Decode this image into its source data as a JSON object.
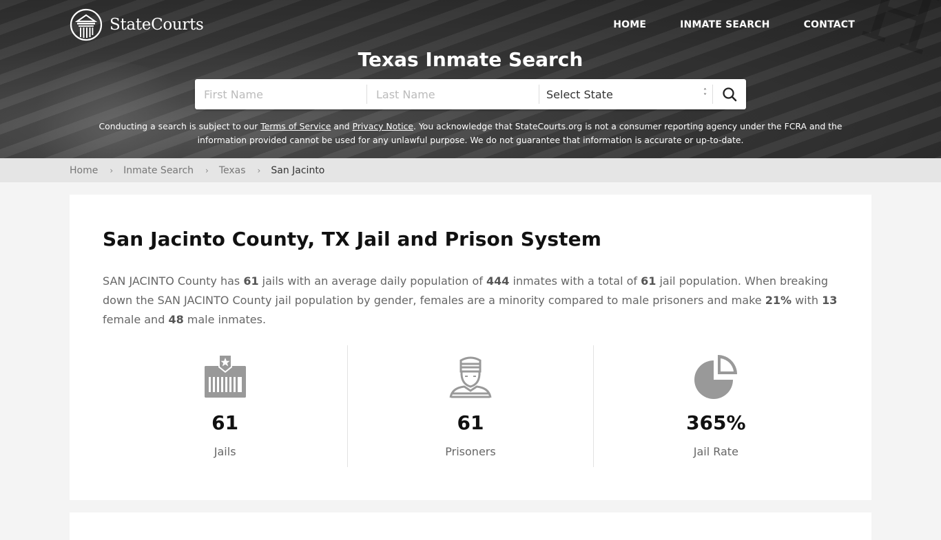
{
  "header": {
    "logo_text": "StateCourts",
    "nav": [
      {
        "label": "HOME"
      },
      {
        "label": "INMATE SEARCH"
      },
      {
        "label": "CONTACT"
      }
    ],
    "background_carving": "RT · HOUSE"
  },
  "hero": {
    "title": "Texas Inmate Search",
    "search": {
      "first_name_placeholder": "First Name",
      "first_name_value": "",
      "last_name_placeholder": "Last Name",
      "last_name_value": "",
      "state_selected": "Select State",
      "search_icon": "search-icon"
    },
    "disclaimer": {
      "part1": "Conducting a search is subject to our ",
      "terms_link": "Terms of Service",
      "part2": " and ",
      "privacy_link": "Privacy Notice",
      "part3": ". You acknowledge that StateCourts.org is not a consumer reporting agency under the FCRA and the information provided cannot be used for any unlawful purpose. We do not guarantee that information is accurate or up-to-date."
    }
  },
  "breadcrumb": {
    "items": [
      {
        "label": "Home"
      },
      {
        "label": "Inmate Search"
      },
      {
        "label": "Texas"
      }
    ],
    "current": "San Jacinto",
    "separator": "›"
  },
  "main": {
    "title": "San Jacinto County, TX Jail and Prison System",
    "intro": {
      "t1": "SAN JACINTO County has ",
      "jails": "61",
      "t2": " jails with an average daily population of ",
      "avg_pop": "444",
      "t3": " inmates with a total of ",
      "total": "61",
      "t4": " jail population. When breaking down the SAN JACINTO County jail population by gender, females are a minority compared to male prisoners and make ",
      "female_pct": "21%",
      "t5": " with ",
      "female_count": "13",
      "t6": " female and ",
      "male_count": "48",
      "t7": " male inmates."
    },
    "stats": [
      {
        "icon": "jail-icon",
        "value": "61",
        "label": "Jails"
      },
      {
        "icon": "prisoner-icon",
        "value": "61",
        "label": "Prisoners"
      },
      {
        "icon": "pie-chart-icon",
        "value": "365%",
        "label": "Jail Rate"
      }
    ]
  },
  "colors": {
    "icon_gray": "#999999",
    "page_bg": "#f4f4f4",
    "breadcrumb_bg": "#e5e5e5",
    "card_bg": "#ffffff",
    "title_text": "#111111",
    "body_text": "#666666"
  }
}
